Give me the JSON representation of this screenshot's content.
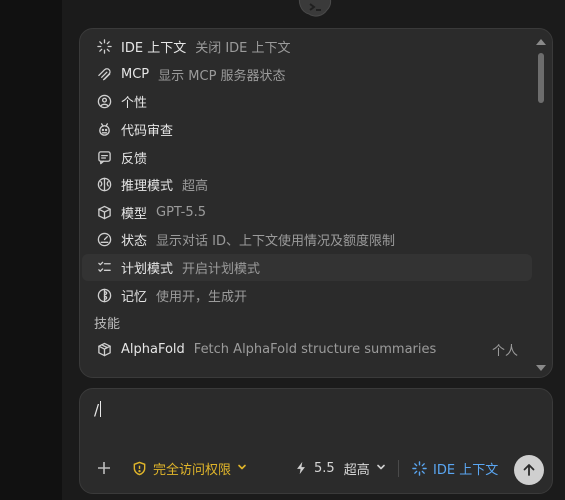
{
  "menu": {
    "items": [
      {
        "label": "IDE 上下文",
        "desc": "关闭 IDE 上下文",
        "icon": "sparkle-icon"
      },
      {
        "label": "MCP",
        "desc": "显示 MCP 服务器状态",
        "icon": "mcp-icon"
      },
      {
        "label": "个性",
        "desc": "",
        "icon": "person-circle-icon"
      },
      {
        "label": "代码审查",
        "desc": "",
        "icon": "bug-icon"
      },
      {
        "label": "反馈",
        "desc": "",
        "icon": "feedback-icon"
      },
      {
        "label": "推理模式",
        "desc": "超高",
        "icon": "brain-icon"
      },
      {
        "label": "模型",
        "desc": "GPT-5.5",
        "icon": "cube-icon"
      },
      {
        "label": "状态",
        "desc": "显示对话 ID、上下文使用情况及额度限制",
        "icon": "gauge-icon"
      },
      {
        "label": "计划模式",
        "desc": "开启计划模式",
        "icon": "checklist-icon"
      },
      {
        "label": "记忆",
        "desc": "使用开，生成开",
        "icon": "memory-icon"
      }
    ],
    "section_header": "技能",
    "skills": [
      {
        "label": "AlphaFold",
        "desc": "Fetch AlphaFold structure summaries",
        "tag": "个人",
        "icon": "package-icon"
      }
    ]
  },
  "composer": {
    "input_value": "/",
    "access_label": "完全访问权限",
    "model_version": "5.5",
    "reasoning_level": "超高",
    "ide_context_label": "IDE 上下文"
  },
  "colors": {
    "accent_blue": "#5aa6f2",
    "warning_yellow": "#e0b52a",
    "panel_bg": "#2b2b2b"
  }
}
